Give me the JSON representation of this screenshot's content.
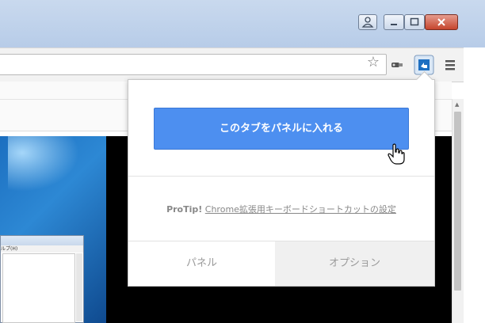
{
  "popup": {
    "primary_button": "このタブをパネルに入れる",
    "protip_bold": "ProTip!",
    "protip_link": "Chrome拡張用キーボードショートカットの設定",
    "tab_panel": "パネル",
    "tab_options": "オプション"
  },
  "toolbar": {
    "icons": [
      "bookmark-star-icon",
      "extension-icon",
      "panel-extension-icon",
      "menu-icon"
    ]
  },
  "window_controls": [
    "user-icon",
    "minimize-icon",
    "maximize-icon",
    "close-icon"
  ],
  "mini_window": {
    "menu_text": "ルプ(H)"
  },
  "colors": {
    "button_blue": "#4d8ff0",
    "titlebar": "#c9d9ee",
    "tab_inactive_bg": "#f0f0f0"
  }
}
